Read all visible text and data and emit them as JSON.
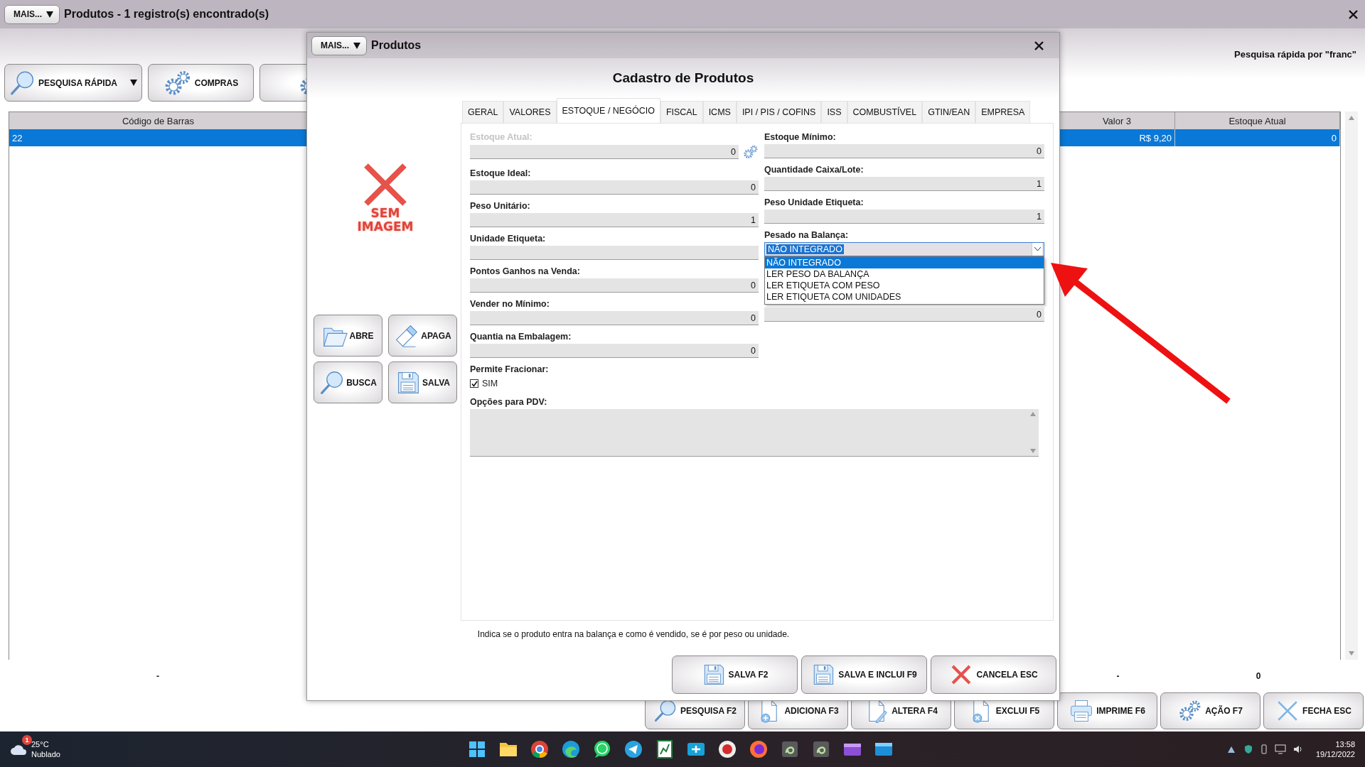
{
  "window": {
    "menu_button": "MAIS...",
    "title": "Produtos - 1 registro(s) encontrado(s)"
  },
  "search_info": "Pesquisa rápida por \"franc\"",
  "toolbar": [
    {
      "label": "PESQUISA RÁPIDA",
      "kind": "search",
      "has_menu": true
    },
    {
      "label": "COMPRAS",
      "kind": "gears",
      "has_menu": false
    },
    {
      "kind": "gears",
      "has_menu": false
    }
  ],
  "table": {
    "columns": [
      "Código de Barras",
      "Valor 3",
      "Estoque Atual"
    ],
    "rows": [
      {
        "cells": [
          "22",
          "R$ 9,20",
          "0"
        ],
        "selected": true
      }
    ],
    "footer": [
      "-",
      "-",
      "0"
    ]
  },
  "actions": [
    {
      "label": "PESQUISA F2",
      "kind": "search"
    },
    {
      "label": "ADICIONA F3",
      "kind": "add"
    },
    {
      "label": "ALTERA F4",
      "kind": "edit"
    },
    {
      "label": "EXCLUI F5",
      "kind": "delete"
    },
    {
      "label": "IMPRIME F6",
      "kind": "print"
    },
    {
      "label": "AÇÃO F7",
      "kind": "gears"
    },
    {
      "label": "FECHA ESC",
      "kind": "close"
    }
  ],
  "modal": {
    "menu_button": "MAIS...",
    "title": "Produtos",
    "heading": "Cadastro de Produtos",
    "image_placeholder": "SEM IMAGEM",
    "image_buttons": [
      {
        "label": "ABRE",
        "kind": "open"
      },
      {
        "label": "APAGA",
        "kind": "erase"
      },
      {
        "label": "BUSCA",
        "kind": "search"
      },
      {
        "label": "SALVA",
        "kind": "save"
      }
    ],
    "tabs": [
      {
        "label": "GERAL",
        "selected": false
      },
      {
        "label": "VALORES",
        "selected": false
      },
      {
        "label": "ESTOQUE / NEGÓCIO",
        "selected": true
      },
      {
        "label": "FISCAL",
        "selected": false
      },
      {
        "label": "ICMS",
        "selected": false
      },
      {
        "label": "IPI / PIS / COFINS",
        "selected": false
      },
      {
        "label": "ISS",
        "selected": false
      },
      {
        "label": "COMBUSTÍVEL",
        "selected": false
      },
      {
        "label": "GTIN/EAN",
        "selected": false
      },
      {
        "label": "EMPRESA",
        "selected": false
      }
    ],
    "left_fields": [
      {
        "kind": "adjustable",
        "label": "Estoque Atual:",
        "value": "0",
        "disabled": true
      },
      {
        "kind": "number",
        "label": "Estoque Ideal:",
        "value": "0"
      },
      {
        "kind": "number",
        "label": "Peso Unitário:",
        "value": "1"
      },
      {
        "kind": "number",
        "label": "Unidade Etiqueta:"
      },
      {
        "kind": "number",
        "label": "Pontos Ganhos na Venda:",
        "value": "0"
      },
      {
        "kind": "number",
        "label": "Vender no Mínimo:",
        "value": "0"
      },
      {
        "kind": "number",
        "label": "Quantia na Embalagem:",
        "value": "0"
      },
      {
        "kind": "checkbox",
        "label": "Permite Fracionar:",
        "option": "SIM",
        "checked": true
      },
      {
        "kind": "textarea",
        "label": "Opções para PDV:"
      }
    ],
    "right_fields": [
      {
        "kind": "number",
        "label": "Estoque Mínimo:",
        "value": "0"
      },
      {
        "kind": "number",
        "label": "Quantidade Caixa/Lote:",
        "value": "1"
      },
      {
        "kind": "number",
        "label": "Peso Unidade Etiqueta:",
        "value": "1"
      },
      {
        "kind": "select",
        "label": "Pesado na Balança:",
        "value": "NÃO INTEGRADO",
        "expanded": true,
        "options": [
          {
            "label": "NÃO INTEGRADO",
            "selected": true
          },
          {
            "label": "LER PESO DA BALANÇA",
            "selected": false
          },
          {
            "label": "LER ETIQUETA COM PESO",
            "selected": false
          },
          {
            "label": "LER ETIQUETA COM UNIDADES",
            "selected": false
          }
        ]
      },
      {
        "kind": "number",
        "value": "0"
      }
    ],
    "hint": "Indica se o produto entra na balança e como é vendido, se é por peso ou unidade.",
    "buttons": [
      {
        "label": "SALVA F2",
        "kind": "save"
      },
      {
        "label": "SALVA E INCLUI F9",
        "kind": "save"
      },
      {
        "label": "CANCELA ESC",
        "kind": "cancel"
      }
    ]
  },
  "taskbar": {
    "weather_badge": "1",
    "temperature": "25°C",
    "weather": "Nublado",
    "time": "13:58",
    "date": "19/12/2022"
  }
}
